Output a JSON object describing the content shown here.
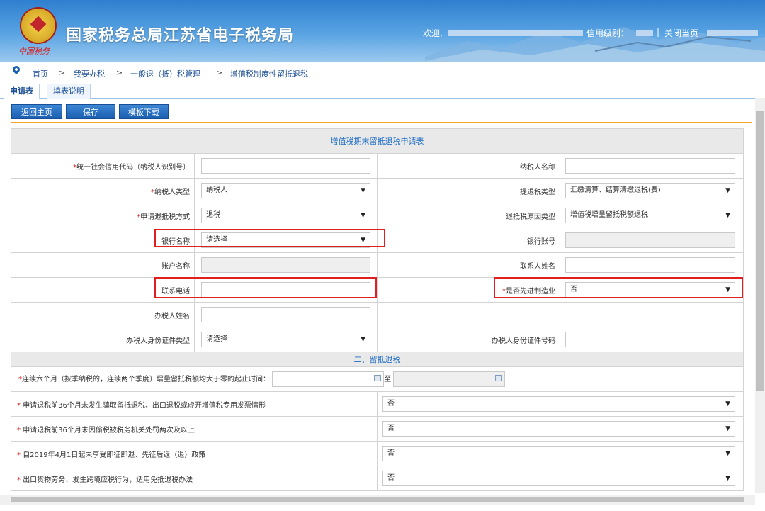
{
  "header": {
    "site_title": "国家税务总局江苏省电子税务局",
    "signature": "中国税务",
    "welcome": "欢迎,",
    "credit_label": "信用级别：",
    "separator": "|",
    "close_label": "关闭当页"
  },
  "breadcrumb": {
    "items": [
      "首页",
      "我要办税",
      "一般退（抵）税管理",
      "增值税制度性留抵退税"
    ],
    "arrow": ">"
  },
  "tabs": [
    "申请表",
    "填表说明"
  ],
  "buttons": {
    "home": "返回主页",
    "save": "保存",
    "template": "模板下载"
  },
  "form": {
    "title": "增值税期末留抵退税申请表",
    "rows": [
      {
        "l_label": "统一社会信用代码（纳税人识别号）",
        "l_required": true,
        "l_value": "",
        "r_label": "纳税人名称",
        "r_value": ""
      },
      {
        "l_label": "纳税人类型",
        "l_required": true,
        "l_value": "纳税人",
        "r_label": "提退税类型",
        "r_value": "汇缴清算、结算清缴退税(费)"
      },
      {
        "l_label": "申请退抵税方式",
        "l_required": true,
        "l_value": "退税",
        "r_label": "退抵税原因类型",
        "r_value": "增值税增量留抵税额退税"
      },
      {
        "l_label": "银行名称",
        "l_value": "请选择",
        "r_label": "银行账号",
        "r_value": ""
      },
      {
        "l_label": "账户名称",
        "l_value": "",
        "r_label": "联系人姓名",
        "r_value": ""
      },
      {
        "l_label": "联系电话",
        "l_value": "",
        "r_label": "是否先进制造业",
        "r_required": true,
        "r_value": "否"
      },
      {
        "l_label": "办税人姓名",
        "l_value": ""
      },
      {
        "l_label": "办税人身份证件类型",
        "l_value": "请选择",
        "r_label": "办税人身份证件号码",
        "r_value": ""
      }
    ],
    "section2": "二、留抵退税",
    "period_label": "连续六个月（按季纳税的，连续两个季度）增量留抵税额均大于零的起止时间：",
    "period_to": "至",
    "questions": [
      {
        "label": "申请退税前36个月未发生骗取留抵退税、出口退税或虚开增值税专用发票情形",
        "value": "否"
      },
      {
        "label": "申请退税前36个月未因偷税被税务机关处罚两次及以上",
        "value": "否"
      },
      {
        "label": "自2019年4月1日起未享受即征即退、先征后返（退）政策",
        "value": "否"
      },
      {
        "label": "出口货物劳务、发生跨境应税行为，适用免抵退税办法",
        "value": "否"
      }
    ],
    "caret": "▼",
    "star": "*"
  },
  "colors": {
    "header_blue": "#2e7fcf",
    "button_blue": "#1c5fb0",
    "accent_orange": "#f5a623",
    "highlight_red": "#e02020",
    "link_blue": "#1c4f95"
  }
}
